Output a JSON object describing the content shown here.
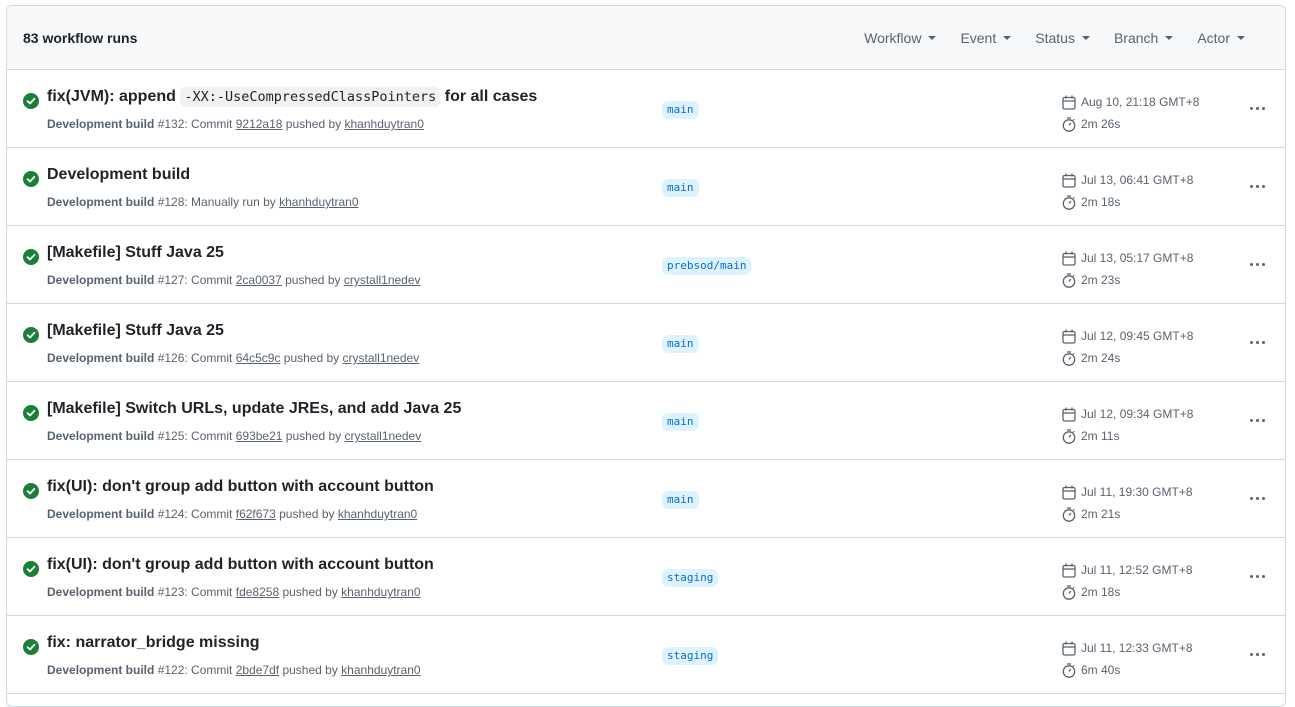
{
  "header": {
    "runs_count": "83 workflow runs",
    "filters": [
      "Workflow",
      "Event",
      "Status",
      "Branch",
      "Actor"
    ]
  },
  "runs": [
    {
      "title_pre": "fix(JVM): append ",
      "title_code": "-XX:-UseCompressedClassPointers",
      "title_post": " for all cases",
      "workflow": "Development build",
      "run_number": "#132",
      "trigger_pre": ": Commit ",
      "commit": "9212a18",
      "trigger_mid": " pushed by ",
      "actor": "khanhduytran0",
      "branch": "main",
      "date": "Aug 10, 21:18 GMT+8",
      "duration": "2m 26s"
    },
    {
      "title_pre": "Development build",
      "title_code": "",
      "title_post": "",
      "workflow": "Development build",
      "run_number": "#128",
      "trigger_pre": ": Manually run by ",
      "commit": "",
      "trigger_mid": "",
      "actor": "khanhduytran0",
      "branch": "main",
      "date": "Jul 13, 06:41 GMT+8",
      "duration": "2m 18s"
    },
    {
      "title_pre": "[Makefile] Stuff Java 25",
      "title_code": "",
      "title_post": "",
      "workflow": "Development build",
      "run_number": "#127",
      "trigger_pre": ": Commit ",
      "commit": "2ca0037",
      "trigger_mid": " pushed by ",
      "actor": "crystall1nedev",
      "branch": "prebsod/main",
      "date": "Jul 13, 05:17 GMT+8",
      "duration": "2m 23s"
    },
    {
      "title_pre": "[Makefile] Stuff Java 25",
      "title_code": "",
      "title_post": "",
      "workflow": "Development build",
      "run_number": "#126",
      "trigger_pre": ": Commit ",
      "commit": "64c5c9c",
      "trigger_mid": " pushed by ",
      "actor": "crystall1nedev",
      "branch": "main",
      "date": "Jul 12, 09:45 GMT+8",
      "duration": "2m 24s"
    },
    {
      "title_pre": "[Makefile] Switch URLs, update JREs, and add Java 25",
      "title_code": "",
      "title_post": "",
      "workflow": "Development build",
      "run_number": "#125",
      "trigger_pre": ": Commit ",
      "commit": "693be21",
      "trigger_mid": " pushed by ",
      "actor": "crystall1nedev",
      "branch": "main",
      "date": "Jul 12, 09:34 GMT+8",
      "duration": "2m 11s"
    },
    {
      "title_pre": "fix(UI): don't group add button with account button",
      "title_code": "",
      "title_post": "",
      "workflow": "Development build",
      "run_number": "#124",
      "trigger_pre": ": Commit ",
      "commit": "f62f673",
      "trigger_mid": " pushed by ",
      "actor": "khanhduytran0",
      "branch": "main",
      "date": "Jul 11, 19:30 GMT+8",
      "duration": "2m 21s"
    },
    {
      "title_pre": "fix(UI): don't group add button with account button",
      "title_code": "",
      "title_post": "",
      "workflow": "Development build",
      "run_number": "#123",
      "trigger_pre": ": Commit ",
      "commit": "fde8258",
      "trigger_mid": " pushed by ",
      "actor": "khanhduytran0",
      "branch": "staging",
      "date": "Jul 11, 12:52 GMT+8",
      "duration": "2m 18s"
    },
    {
      "title_pre": "fix: narrator_bridge missing",
      "title_code": "",
      "title_post": "",
      "workflow": "Development build",
      "run_number": "#122",
      "trigger_pre": ": Commit ",
      "commit": "2bde7df",
      "trigger_mid": " pushed by ",
      "actor": "khanhduytran0",
      "branch": "staging",
      "date": "Jul 11, 12:33 GMT+8",
      "duration": "6m 40s"
    }
  ],
  "icons": {
    "status": "check-circle-fill-icon",
    "calendar": "calendar-icon",
    "stopwatch": "stopwatch-icon",
    "kebab": "kebab-horizontal-icon"
  },
  "colors": {
    "success": "#1a7f37",
    "branch_bg": "#ddf4ff",
    "branch_fg": "#0969da",
    "muted": "#59636e"
  }
}
